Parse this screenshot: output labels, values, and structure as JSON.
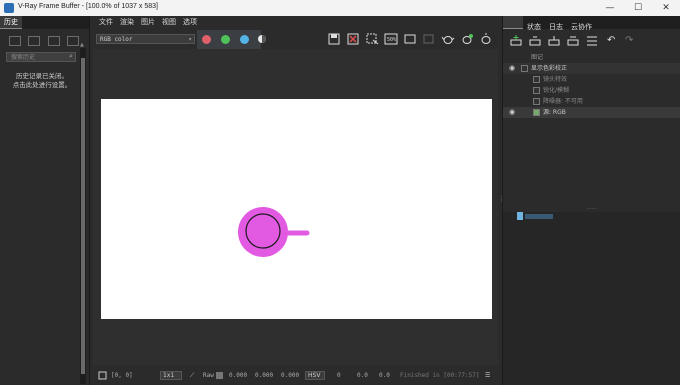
{
  "window": {
    "title": "V-Ray Frame Buffer - [100.0% of 1037 x 583]",
    "minimize": "—",
    "maximize": "☐",
    "close": "✕"
  },
  "left_panel": {
    "tab": "历史",
    "search_placeholder": "搜索历史",
    "message": "历史记录已关闭。\n点击此处进行设置。"
  },
  "menu": [
    "文件",
    "渲染",
    "图片",
    "视图",
    "选项"
  ],
  "toolbar": {
    "channel": "RGB color",
    "channel_colors": [
      "#e0606a",
      "#4fc25a",
      "#55b4e6"
    ]
  },
  "status": {
    "coords": "[0, 0]",
    "zoom": "1x1",
    "mode": "Raw",
    "values": [
      "0.000",
      "0.000",
      "0.000"
    ],
    "colorspace": "HSV",
    "hsv": [
      "0",
      "0.0",
      "0.0"
    ],
    "message": "Finished in [00:77:57]"
  },
  "right_panel": {
    "tabs": [
      "状态",
      "日志",
      "云协作"
    ],
    "layers": [
      {
        "label": "图记",
        "eye": false,
        "indent": 0
      },
      {
        "label": "显示色彩校正",
        "eye": true,
        "indent": 0
      },
      {
        "label": "镜头特效",
        "eye": false,
        "indent": 1
      },
      {
        "label": "锐化/模糊",
        "eye": false,
        "indent": 1
      },
      {
        "label": "降噪器: 不可用",
        "eye": false,
        "indent": 1
      },
      {
        "label": "源: RGB",
        "eye": true,
        "indent": 1
      }
    ]
  },
  "colors": {
    "teapot": "#e25ae2",
    "teapot_outline": "#1a1a1a",
    "background": "#2b2b2b"
  }
}
